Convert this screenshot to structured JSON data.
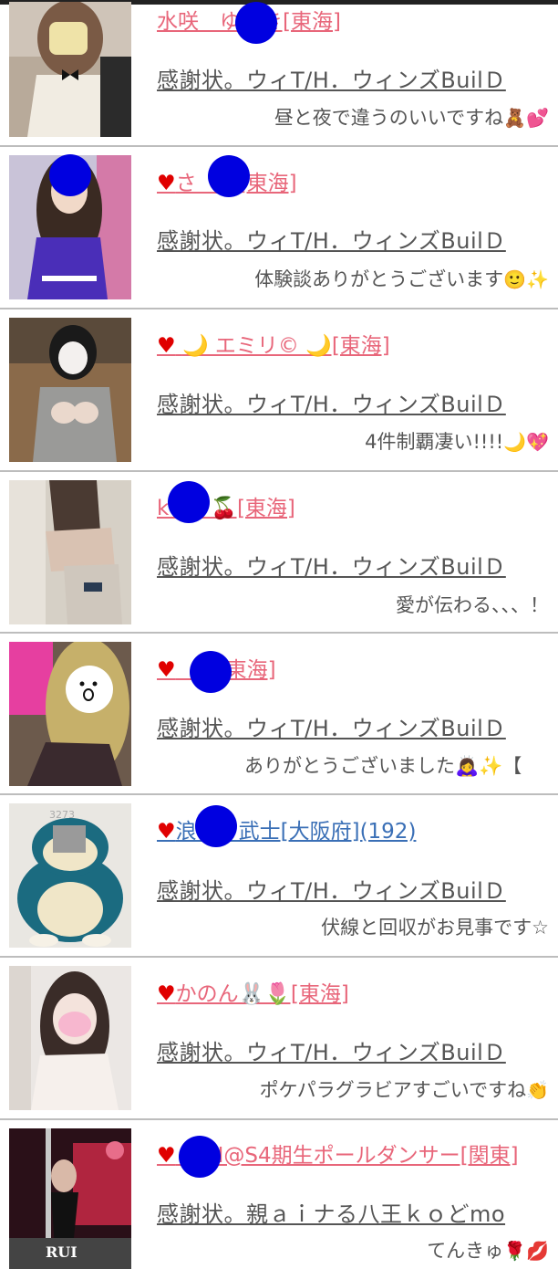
{
  "items": [
    {
      "name": "水咲　ゆ　き[東海]",
      "title": "感謝状。ウィT/H．ウィンズBuilＤ",
      "comment": "昼と夜で違うのいいですね",
      "comment_icons": [
        "🧸",
        "💕"
      ],
      "name_icons": [],
      "heart": false,
      "link_color": "pink"
    },
    {
      "name": "さ　ゆ[東海]",
      "title": "感謝状。ウィT/H．ウィンズBuilＤ",
      "comment": "体験談ありがとうございます",
      "comment_icons": [
        "🙂",
        "✨"
      ],
      "name_icons": [],
      "heart": true,
      "link_color": "pink"
    },
    {
      "name": "🌙 エミリ© 🌙[東海]",
      "title": "感謝状。ウィT/H．ウィンズBuilＤ",
      "comment": "4件制覇凄い!!!!",
      "comment_icons": [
        "🌙",
        "💖"
      ],
      "name_icons": [],
      "heart": true,
      "link_color": "pink"
    },
    {
      "name": "k　　🍒[東海]",
      "title": "感謝状。ウィT/H．ウィンズBuilＤ",
      "comment": "愛が伝わる、、、！",
      "comment_icons": [],
      "name_icons": [],
      "heart": false,
      "link_color": "pink"
    },
    {
      "name": "　　[東海]",
      "title": "感謝状。ウィT/H．ウィンズBuilＤ",
      "comment": "ありがとうございました🙇‍♀️✨【",
      "comment_icons": [],
      "name_icons": [],
      "heart": true,
      "link_color": "pink"
    },
    {
      "name": "浪　　武士[大阪府](192)",
      "title": "感謝状。ウィT/H．ウィンズBuilＤ",
      "comment": "伏線と回収がお見事です☆",
      "comment_icons": [],
      "name_icons": [],
      "heart": true,
      "link_color": "blue"
    },
    {
      "name": "かのん🐰🌷[東海]",
      "title": "感謝状。ウィT/H．ウィンズBuilＤ",
      "comment": "ポケパラグラビアすごいですね",
      "comment_icons": [
        "👏"
      ],
      "name_icons": [],
      "heart": true,
      "link_color": "pink"
    },
    {
      "name": "　　I@S4期生ポールダンサー[関東]",
      "title": "感謝状。親ａｉナる八王ｋｏどmo",
      "comment": "てんきゅ",
      "comment_icons": [
        "🌹",
        "💋"
      ],
      "name_icons": [],
      "heart": true,
      "link_color": "pink"
    }
  ],
  "thumb_texts": {
    "item6": "3273",
    "item8": "RUI"
  },
  "colors": {
    "link_pink": "#e8667a",
    "link_blue": "#3a6fb6",
    "heart": "#e00000",
    "divider": "#bdbdbd",
    "text": "#555555"
  }
}
